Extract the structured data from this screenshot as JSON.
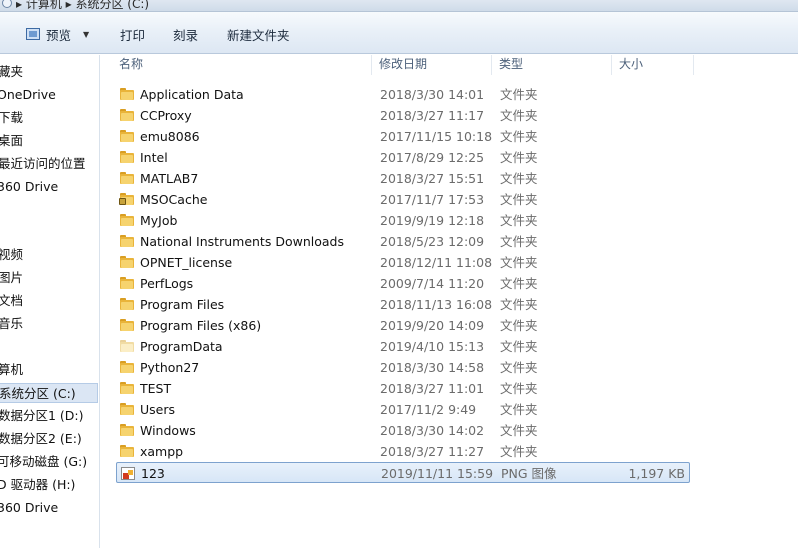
{
  "address": {
    "breadcrumb": "▸ 计算机 ▸ 系统分区 (C:)"
  },
  "toolbar": {
    "preview_label": "预览",
    "print_label": "打印",
    "burn_label": "刻录",
    "new_folder_label": "新建文件夹"
  },
  "navpane": {
    "items": [
      {
        "label": "藏夹",
        "icon": "star-icon"
      },
      {
        "label": "OneDrive",
        "icon": "cloud-icon"
      },
      {
        "label": "下载",
        "icon": "download-icon"
      },
      {
        "label": "桌面",
        "icon": "desktop-icon"
      },
      {
        "label": "最近访问的位置",
        "icon": "recent-icon"
      },
      {
        "label": "360 Drive",
        "icon": "drive-icon"
      },
      {
        "label": "视频",
        "icon": "video-icon"
      },
      {
        "label": "图片",
        "icon": "picture-icon"
      },
      {
        "label": "文档",
        "icon": "document-icon"
      },
      {
        "label": "音乐",
        "icon": "music-icon"
      },
      {
        "label": "算机",
        "icon": "computer-icon"
      },
      {
        "label": "系统分区 (C:)",
        "icon": "disk-icon",
        "selected": true
      },
      {
        "label": "数据分区1 (D:)",
        "icon": "disk-icon"
      },
      {
        "label": "数据分区2 (E:)",
        "icon": "disk-icon"
      },
      {
        "label": "可移动磁盘 (G:)",
        "icon": "usb-icon"
      },
      {
        "label": "D 驱动器 (H:)",
        "icon": "cd-drive-icon"
      },
      {
        "label": "360 Drive",
        "icon": "drive-icon"
      }
    ]
  },
  "columns": {
    "name": "名称",
    "date": "修改日期",
    "type": "类型",
    "size": "大小"
  },
  "files": [
    {
      "name": "Application Data",
      "date": "2018/3/30 14:01",
      "type": "文件夹",
      "size": "",
      "icon": "folder-icon"
    },
    {
      "name": "CCProxy",
      "date": "2018/3/27 11:17",
      "type": "文件夹",
      "size": "",
      "icon": "folder-icon"
    },
    {
      "name": "emu8086",
      "date": "2017/11/15 10:18",
      "type": "文件夹",
      "size": "",
      "icon": "folder-icon"
    },
    {
      "name": "Intel",
      "date": "2017/8/29 12:25",
      "type": "文件夹",
      "size": "",
      "icon": "folder-icon"
    },
    {
      "name": "MATLAB7",
      "date": "2018/3/27 15:51",
      "type": "文件夹",
      "size": "",
      "icon": "folder-icon"
    },
    {
      "name": "MSOCache",
      "date": "2017/11/7 17:53",
      "type": "文件夹",
      "size": "",
      "icon": "locked-folder-icon"
    },
    {
      "name": "MyJob",
      "date": "2019/9/19 12:18",
      "type": "文件夹",
      "size": "",
      "icon": "folder-icon"
    },
    {
      "name": "National Instruments Downloads",
      "date": "2018/5/23 12:09",
      "type": "文件夹",
      "size": "",
      "icon": "folder-icon"
    },
    {
      "name": "OPNET_license",
      "date": "2018/12/11 11:08",
      "type": "文件夹",
      "size": "",
      "icon": "folder-icon"
    },
    {
      "name": "PerfLogs",
      "date": "2009/7/14 11:20",
      "type": "文件夹",
      "size": "",
      "icon": "folder-icon"
    },
    {
      "name": "Program Files",
      "date": "2018/11/13 16:08",
      "type": "文件夹",
      "size": "",
      "icon": "folder-icon"
    },
    {
      "name": "Program Files (x86)",
      "date": "2019/9/20 14:09",
      "type": "文件夹",
      "size": "",
      "icon": "folder-icon"
    },
    {
      "name": "ProgramData",
      "date": "2019/4/10 15:13",
      "type": "文件夹",
      "size": "",
      "icon": "hidden-folder-icon"
    },
    {
      "name": "Python27",
      "date": "2018/3/30 14:58",
      "type": "文件夹",
      "size": "",
      "icon": "folder-icon"
    },
    {
      "name": "TEST",
      "date": "2018/3/27 11:01",
      "type": "文件夹",
      "size": "",
      "icon": "folder-icon"
    },
    {
      "name": "Users",
      "date": "2017/11/2 9:49",
      "type": "文件夹",
      "size": "",
      "icon": "folder-icon"
    },
    {
      "name": "Windows",
      "date": "2018/3/30 14:02",
      "type": "文件夹",
      "size": "",
      "icon": "folder-icon"
    },
    {
      "name": "xampp",
      "date": "2018/3/27 11:27",
      "type": "文件夹",
      "size": "",
      "icon": "folder-icon"
    },
    {
      "name": "123",
      "date": "2019/11/11 15:59",
      "type": "PNG 图像",
      "size": "1,197 KB",
      "icon": "png-image-icon",
      "selected": true
    }
  ]
}
